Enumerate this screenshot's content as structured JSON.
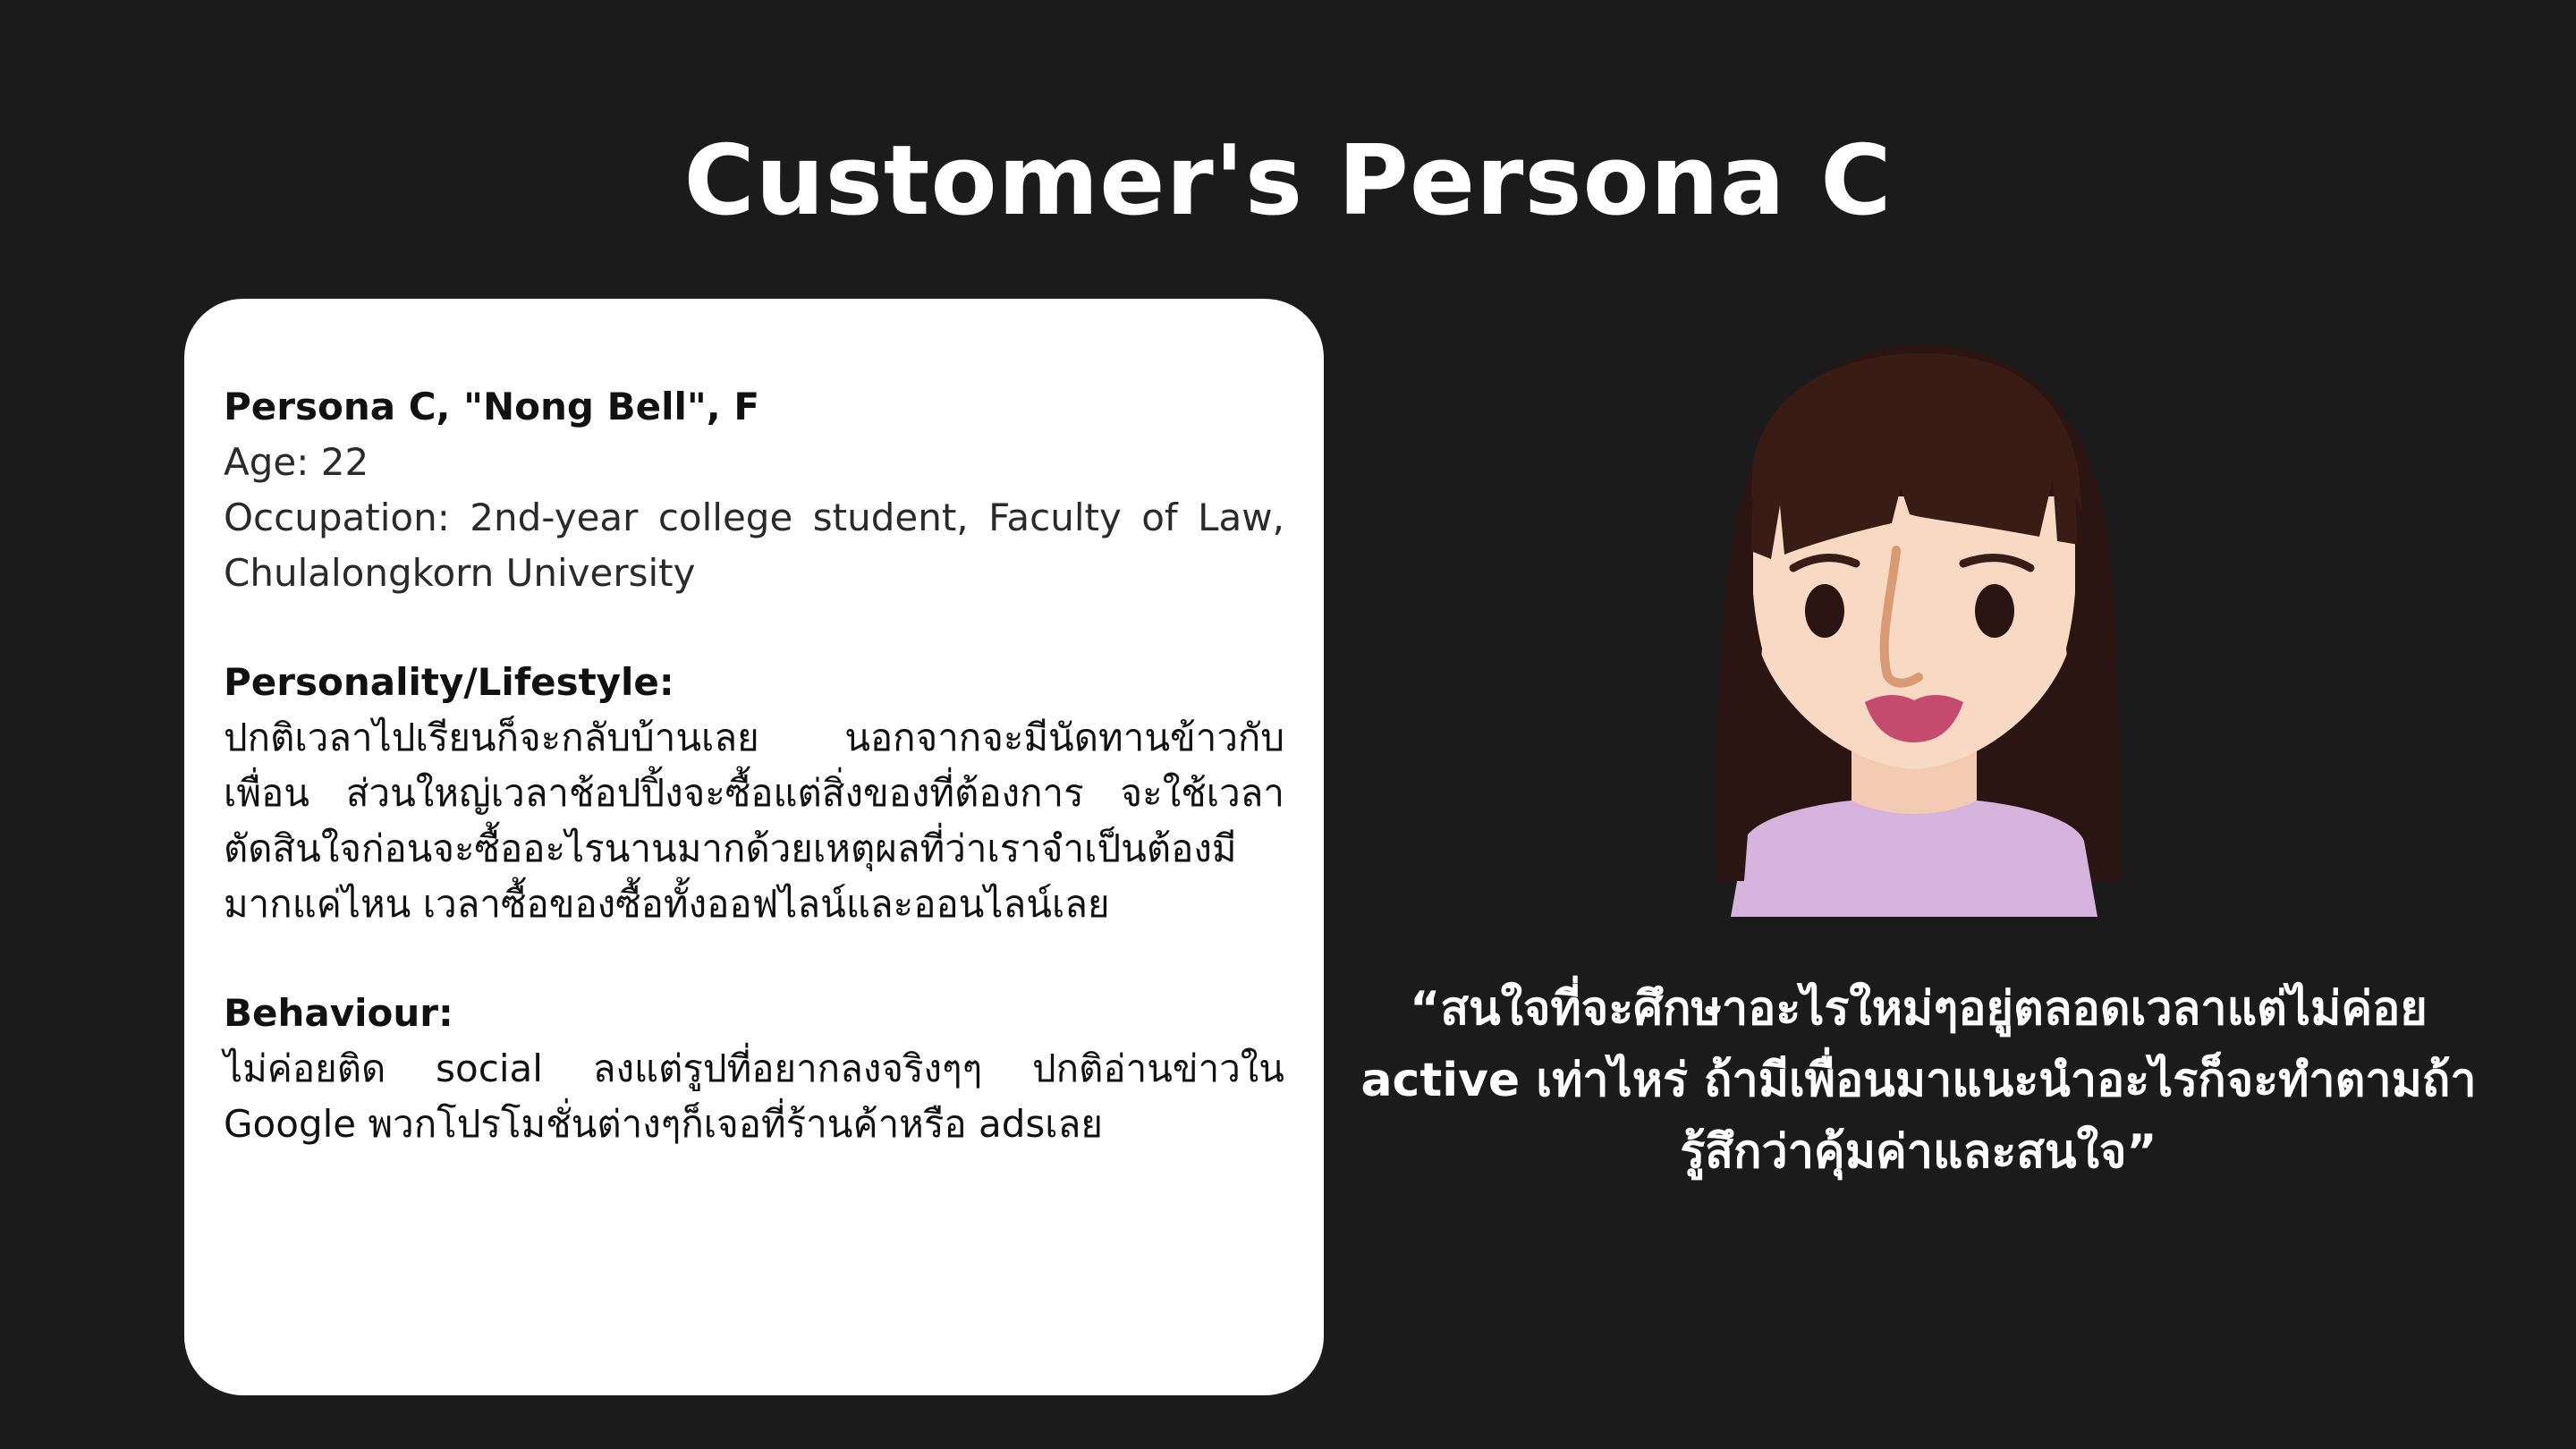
{
  "title": "Customer's Persona C",
  "persona": {
    "name_line": "Persona C, \"Nong Bell\", F",
    "age": "Age: 22",
    "occupation": "Occupation: 2nd-year college student, Faculty of Law, Chulalongkorn University",
    "personality_heading": "Personality/Lifestyle:",
    "personality_text": "ปกติเวลาไปเรียนก็จะกลับบ้านเลย นอกจากจะมีนัดทานข้าวกับเพื่อน ส่วนใหญ่เวลาช้อปปิ้งจะซื้อแต่สิ่งของที่ต้องการ จะใช้เวลาตัดสินใจก่อนจะซื้ออะไรนานมากด้วยเหตุผลที่ว่าเราจำเป็นต้องมีมากแค่ไหน เวลาซื้อของซื้อทั้งออฟไลน์และออนไลน์เลย",
    "behaviour_heading": "Behaviour:",
    "behaviour_text": "ไม่ค่อยติด social ลงแต่รูปที่อยากลงจริงๆๆ ปกติอ่านข่าวใน Google พวกโปรโมชั่นต่างๆก็เจอที่ร้านค้าหรือ adsเลย"
  },
  "quote": "“สนใจที่จะศึกษาอะไรใหม่ๆอยู่ตลอดเวลาแต่ไม่ค่อย active เท่าไหร่ ถ้ามีเพื่อนมาแนะนำอะไรก็จะทำตามถ้ารู้สึกว่าคุ้มค่าและสนใจ”",
  "avatar": {
    "icon": "woman-avatar-illustration",
    "colors": {
      "hair": "#2a1512",
      "skin": "#f8d9c3",
      "lips": "#c44a6e",
      "shirt": "#d6b3dc",
      "nose": "#d99a74"
    }
  }
}
